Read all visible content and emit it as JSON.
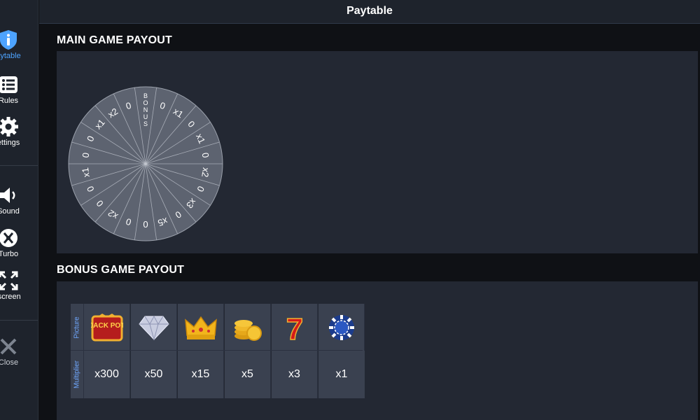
{
  "header": {
    "title": "Paytable"
  },
  "sidebar": {
    "items": [
      {
        "label": "aytable",
        "icon": "info-shield-icon",
        "active": true
      },
      {
        "label": "Rules",
        "icon": "list-icon"
      },
      {
        "label": "ettings",
        "icon": "gear-icon"
      },
      {
        "label": "Sound",
        "icon": "speaker-icon"
      },
      {
        "label": "Turbo",
        "icon": "turbo-icon"
      },
      {
        "label": "lscreen",
        "icon": "fullscreen-icon"
      },
      {
        "label": "Close",
        "icon": "close-icon"
      }
    ]
  },
  "main_section": {
    "title": "MAIN GAME PAYOUT",
    "wheel_segments": [
      "BONUS",
      "0",
      "x1",
      "0",
      "x1",
      "0",
      "x2",
      "0",
      "x3",
      "0",
      "x5",
      "0",
      "0",
      "x2",
      "0",
      "0",
      "x1",
      "0",
      "0",
      "x1",
      "x2",
      "0"
    ]
  },
  "bonus_section": {
    "title": "BONUS GAME PAYOUT",
    "row_labels": {
      "picture": "Picture",
      "multiplier": "Multiplier"
    },
    "symbols": [
      {
        "icon": "jackpot-icon",
        "jackpot_text": "JACK POT",
        "multiplier": "x300"
      },
      {
        "icon": "diamond-icon",
        "multiplier": "x50"
      },
      {
        "icon": "crown-icon",
        "multiplier": "x15"
      },
      {
        "icon": "gold-coins-icon",
        "multiplier": "x5"
      },
      {
        "icon": "lucky-seven-icon",
        "seven": "7",
        "multiplier": "x3"
      },
      {
        "icon": "poker-chip-icon",
        "multiplier": "x1"
      }
    ]
  },
  "colors": {
    "accent": "#4da3ff",
    "panel": "#232833",
    "table": "#3a4150",
    "background": "#0f1115"
  }
}
